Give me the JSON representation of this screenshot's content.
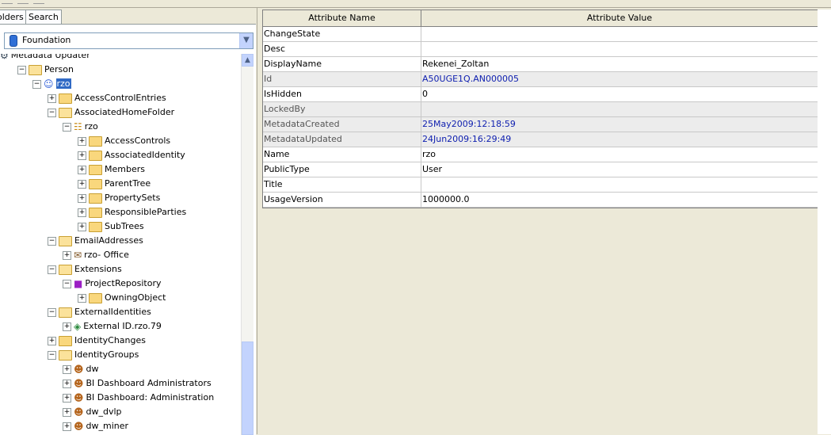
{
  "tabs": [
    "olders",
    "Search"
  ],
  "repository": {
    "selected": "Foundation"
  },
  "tree": [
    {
      "label": "Metadata Updater",
      "level": 0,
      "icon": "updater-icon",
      "exp": "",
      "partial": true
    },
    {
      "label": "Person",
      "level": 1,
      "icon": "folder-open-icon",
      "exp": "-"
    },
    {
      "label": "rzo",
      "level": 2,
      "icon": "person-icon",
      "exp": "-",
      "selected": true
    },
    {
      "label": "AccessControlEntries",
      "level": 3,
      "icon": "folder-icon",
      "exp": "+"
    },
    {
      "label": "AssociatedHomeFolder",
      "level": 3,
      "icon": "folder-open-icon",
      "exp": "-"
    },
    {
      "label": "rzo",
      "level": 4,
      "icon": "tree-folder-icon",
      "exp": "-"
    },
    {
      "label": "AccessControls",
      "level": 5,
      "icon": "folder-icon",
      "exp": "+"
    },
    {
      "label": "AssociatedIdentity",
      "level": 5,
      "icon": "folder-icon",
      "exp": "+"
    },
    {
      "label": "Members",
      "level": 5,
      "icon": "folder-icon",
      "exp": "+"
    },
    {
      "label": "ParentTree",
      "level": 5,
      "icon": "folder-icon",
      "exp": "+"
    },
    {
      "label": "PropertySets",
      "level": 5,
      "icon": "folder-icon",
      "exp": "+"
    },
    {
      "label": "ResponsibleParties",
      "level": 5,
      "icon": "folder-icon",
      "exp": "+"
    },
    {
      "label": "SubTrees",
      "level": 5,
      "icon": "folder-icon",
      "exp": "+"
    },
    {
      "label": "EmailAddresses",
      "level": 3,
      "icon": "folder-open-icon",
      "exp": "-"
    },
    {
      "label": "rzo- Office",
      "level": 4,
      "icon": "email-icon",
      "exp": "+"
    },
    {
      "label": "Extensions",
      "level": 3,
      "icon": "folder-open-icon",
      "exp": "-"
    },
    {
      "label": "ProjectRepository",
      "level": 4,
      "icon": "repository-icon",
      "exp": "-"
    },
    {
      "label": "OwningObject",
      "level": 5,
      "icon": "folder-icon",
      "exp": "+"
    },
    {
      "label": "ExternalIdentities",
      "level": 3,
      "icon": "folder-open-icon",
      "exp": "-"
    },
    {
      "label": "External ID.rzo.79",
      "level": 4,
      "icon": "external-id-icon",
      "exp": "+"
    },
    {
      "label": "IdentityChanges",
      "level": 3,
      "icon": "folder-icon",
      "exp": "+"
    },
    {
      "label": "IdentityGroups",
      "level": 3,
      "icon": "folder-open-icon",
      "exp": "-"
    },
    {
      "label": "dw",
      "level": 4,
      "icon": "group-icon",
      "exp": "+"
    },
    {
      "label": "BI Dashboard Administrators",
      "level": 4,
      "icon": "group-icon",
      "exp": "+"
    },
    {
      "label": "BI Dashboard: Administration",
      "level": 4,
      "icon": "group-icon",
      "exp": "+"
    },
    {
      "label": "dw_dvlp",
      "level": 4,
      "icon": "group-icon",
      "exp": "+"
    },
    {
      "label": "dw_miner",
      "level": 4,
      "icon": "group-icon",
      "exp": "+"
    }
  ],
  "grid": {
    "headers": [
      "Attribute Name",
      "Attribute Value"
    ],
    "rows": [
      {
        "name": "ChangeState",
        "value": "",
        "readonly": false,
        "blue": false
      },
      {
        "name": "Desc",
        "value": "",
        "readonly": false,
        "blue": false
      },
      {
        "name": "DisplayName",
        "value": "Rekenei_Zoltan",
        "readonly": false,
        "blue": false
      },
      {
        "name": "Id",
        "value": "A50UGE1Q.AN000005",
        "readonly": true,
        "blue": true
      },
      {
        "name": "IsHidden",
        "value": "0",
        "readonly": false,
        "blue": false
      },
      {
        "name": "LockedBy",
        "value": "",
        "readonly": true,
        "blue": false
      },
      {
        "name": "MetadataCreated",
        "value": "25May2009:12:18:59",
        "readonly": true,
        "blue": true
      },
      {
        "name": "MetadataUpdated",
        "value": "24Jun2009:16:29:49",
        "readonly": true,
        "blue": true
      },
      {
        "name": "Name",
        "value": "rzo",
        "readonly": false,
        "blue": false
      },
      {
        "name": "PublicType",
        "value": "User",
        "readonly": false,
        "blue": false
      },
      {
        "name": "Title",
        "value": "",
        "readonly": false,
        "blue": false
      },
      {
        "name": "UsageVersion",
        "value": "1000000.0",
        "readonly": false,
        "blue": false
      }
    ]
  }
}
